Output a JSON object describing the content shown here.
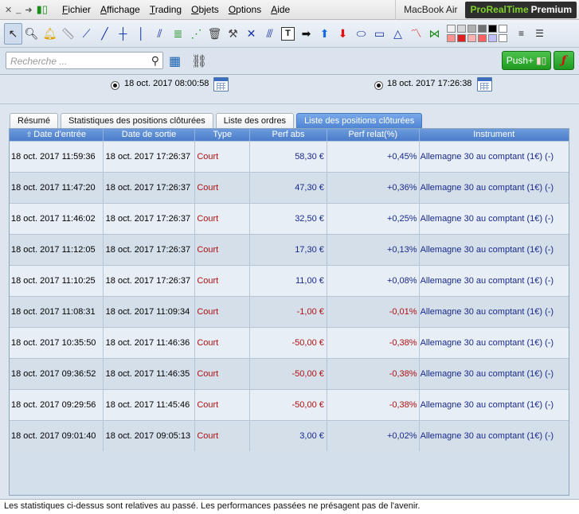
{
  "menu": {
    "items": [
      "Fichier",
      "Affichage",
      "Trading",
      "Objets",
      "Options",
      "Aide"
    ],
    "device": "MacBook Air",
    "brand_green": "ProRealTime",
    "brand_white": "Premium"
  },
  "search": {
    "placeholder": "Recherche ..."
  },
  "push_label": "Push+",
  "dates": {
    "start": "18 oct. 2017 08:00:58",
    "end": "18 oct. 2017 17:26:38"
  },
  "tabs": [
    {
      "label": "Résumé",
      "active": false
    },
    {
      "label": "Statistiques des positions clôturées",
      "active": false
    },
    {
      "label": "Liste des ordres",
      "active": false
    },
    {
      "label": "Liste des positions clôturées",
      "active": true
    }
  ],
  "table": {
    "headers": [
      "Date d'entrée",
      "Date de sortie",
      "Type",
      "Perf abs",
      "Perf relat(%)",
      "Instrument"
    ],
    "rows": [
      {
        "entry": "18 oct. 2017 11:59:36",
        "exit": "18 oct. 2017 17:26:37",
        "type": "Court",
        "perf_abs": "58,30 €",
        "perf_rel": "+0,45%",
        "instrument": "Allemagne 30 au comptant (1€) (-)",
        "negative": false
      },
      {
        "entry": "18 oct. 2017 11:47:20",
        "exit": "18 oct. 2017 17:26:37",
        "type": "Court",
        "perf_abs": "47,30 €",
        "perf_rel": "+0,36%",
        "instrument": "Allemagne 30 au comptant (1€) (-)",
        "negative": false
      },
      {
        "entry": "18 oct. 2017 11:46:02",
        "exit": "18 oct. 2017 17:26:37",
        "type": "Court",
        "perf_abs": "32,50 €",
        "perf_rel": "+0,25%",
        "instrument": "Allemagne 30 au comptant (1€) (-)",
        "negative": false
      },
      {
        "entry": "18 oct. 2017 11:12:05",
        "exit": "18 oct. 2017 17:26:37",
        "type": "Court",
        "perf_abs": "17,30 €",
        "perf_rel": "+0,13%",
        "instrument": "Allemagne 30 au comptant (1€) (-)",
        "negative": false
      },
      {
        "entry": "18 oct. 2017 11:10:25",
        "exit": "18 oct. 2017 17:26:37",
        "type": "Court",
        "perf_abs": "11,00 €",
        "perf_rel": "+0,08%",
        "instrument": "Allemagne 30 au comptant (1€) (-)",
        "negative": false
      },
      {
        "entry": "18 oct. 2017 11:08:31",
        "exit": "18 oct. 2017 11:09:34",
        "type": "Court",
        "perf_abs": "-1,00 €",
        "perf_rel": "-0,01%",
        "instrument": "Allemagne 30 au comptant (1€) (-)",
        "negative": true
      },
      {
        "entry": "18 oct. 2017 10:35:50",
        "exit": "18 oct. 2017 11:46:36",
        "type": "Court",
        "perf_abs": "-50,00 €",
        "perf_rel": "-0,38%",
        "instrument": "Allemagne 30 au comptant (1€) (-)",
        "negative": true
      },
      {
        "entry": "18 oct. 2017 09:36:52",
        "exit": "18 oct. 2017 11:46:35",
        "type": "Court",
        "perf_abs": "-50,00 €",
        "perf_rel": "-0,38%",
        "instrument": "Allemagne 30 au comptant (1€) (-)",
        "negative": true
      },
      {
        "entry": "18 oct. 2017 09:29:56",
        "exit": "18 oct. 2017 11:45:46",
        "type": "Court",
        "perf_abs": "-50,00 €",
        "perf_rel": "-0,38%",
        "instrument": "Allemagne 30 au comptant (1€) (-)",
        "negative": true
      },
      {
        "entry": "18 oct. 2017 09:01:40",
        "exit": "18 oct. 2017 09:05:13",
        "type": "Court",
        "perf_abs": "3,00 €",
        "perf_rel": "+0,02%",
        "instrument": "Allemagne 30 au comptant (1€) (-)",
        "negative": false
      }
    ]
  },
  "footer": "Les statistiques ci-dessus sont relatives au passé. Les performances passées ne présagent pas de l'avenir.",
  "colors": {
    "accent_blue": "#4f85d4",
    "positive": "#1a2a8c",
    "negative": "#b01010",
    "push_green": "#1f9a1f"
  },
  "palette": [
    "#f0f0f0",
    "#d8d8d8",
    "#b0b0b0",
    "#707070",
    "#000000",
    "#ffffff",
    "#ff9090",
    "#e02020",
    "#ffb0b0",
    "#ff6060",
    "#c0c0ff",
    "#ffffff"
  ]
}
